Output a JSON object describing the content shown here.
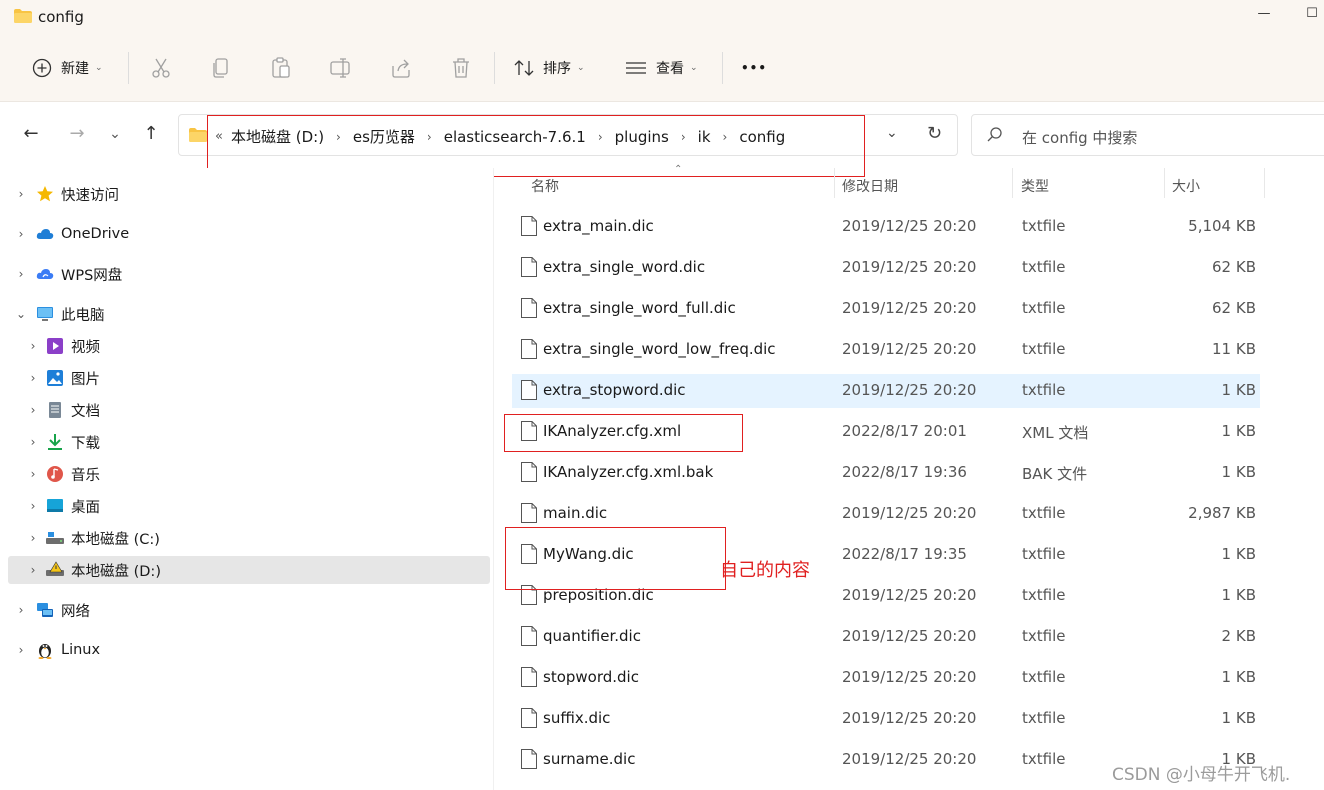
{
  "window": {
    "title": "config",
    "minimize": "—",
    "maximize": "☐"
  },
  "toolbar": {
    "new_label": "新建",
    "sort_label": "排序",
    "view_label": "查看",
    "more_label": "•••"
  },
  "nav": {
    "back": "←",
    "forward": "→",
    "recent": "⌄",
    "up": "↑"
  },
  "address": {
    "lead": "«",
    "crumbs": [
      "本地磁盘 (D:)",
      "es历览器",
      "elasticsearch-7.6.1",
      "plugins",
      "ik",
      "config"
    ],
    "dropdown": "⌄",
    "refresh": "↻"
  },
  "search": {
    "placeholder": "在 config 中搜索"
  },
  "sidebar": {
    "items": [
      {
        "label": "快速访问",
        "icon": "star-icon"
      },
      {
        "label": "OneDrive",
        "icon": "cloud-icon"
      },
      {
        "label": "WPS网盘",
        "icon": "wps-cloud-icon"
      },
      {
        "label": "此电脑",
        "icon": "computer-icon"
      },
      {
        "label": "视频",
        "icon": "video-icon"
      },
      {
        "label": "图片",
        "icon": "picture-icon"
      },
      {
        "label": "文档",
        "icon": "document-icon"
      },
      {
        "label": "下载",
        "icon": "download-icon"
      },
      {
        "label": "音乐",
        "icon": "music-icon"
      },
      {
        "label": "桌面",
        "icon": "desktop-icon"
      },
      {
        "label": "本地磁盘 (C:)",
        "icon": "drive-icon"
      },
      {
        "label": "本地磁盘 (D:)",
        "icon": "drive-warning-icon"
      },
      {
        "label": "网络",
        "icon": "network-icon"
      },
      {
        "label": "Linux",
        "icon": "linux-penguin-icon"
      }
    ],
    "selected": "本地磁盘 (D:)"
  },
  "columns": {
    "name": "名称",
    "date": "修改日期",
    "type": "类型",
    "size": "大小"
  },
  "files": [
    {
      "name": "extra_main.dic",
      "date": "2019/12/25 20:20",
      "type": "txtfile",
      "size": "5,104 KB"
    },
    {
      "name": "extra_single_word.dic",
      "date": "2019/12/25 20:20",
      "type": "txtfile",
      "size": "62 KB"
    },
    {
      "name": "extra_single_word_full.dic",
      "date": "2019/12/25 20:20",
      "type": "txtfile",
      "size": "62 KB"
    },
    {
      "name": "extra_single_word_low_freq.dic",
      "date": "2019/12/25 20:20",
      "type": "txtfile",
      "size": "11 KB"
    },
    {
      "name": "extra_stopword.dic",
      "date": "2019/12/25 20:20",
      "type": "txtfile",
      "size": "1 KB"
    },
    {
      "name": "IKAnalyzer.cfg.xml",
      "date": "2022/8/17 20:01",
      "type": "XML 文档",
      "size": "1 KB"
    },
    {
      "name": "IKAnalyzer.cfg.xml.bak",
      "date": "2022/8/17 19:36",
      "type": "BAK 文件",
      "size": "1 KB"
    },
    {
      "name": "main.dic",
      "date": "2019/12/25 20:20",
      "type": "txtfile",
      "size": "2,987 KB"
    },
    {
      "name": "MyWang.dic",
      "date": "2022/8/17 19:35",
      "type": "txtfile",
      "size": "1 KB"
    },
    {
      "name": "preposition.dic",
      "date": "2019/12/25 20:20",
      "type": "txtfile",
      "size": "1 KB"
    },
    {
      "name": "quantifier.dic",
      "date": "2019/12/25 20:20",
      "type": "txtfile",
      "size": "2 KB"
    },
    {
      "name": "stopword.dic",
      "date": "2019/12/25 20:20",
      "type": "txtfile",
      "size": "1 KB"
    },
    {
      "name": "suffix.dic",
      "date": "2019/12/25 20:20",
      "type": "txtfile",
      "size": "1 KB"
    },
    {
      "name": "surname.dic",
      "date": "2019/12/25 20:20",
      "type": "txtfile",
      "size": "1 KB"
    }
  ],
  "hovered_file": "extra_stopword.dic",
  "annotation": "自己的内容",
  "watermark": "CSDN @小母牛开飞机.",
  "colors": {
    "toolbar_bg": "#faf6f1",
    "hover_row": "#e5f3ff",
    "selected_nav": "#e6e6e6",
    "annotation_red": "#e02020",
    "folder_yellow": "#f8c444"
  }
}
